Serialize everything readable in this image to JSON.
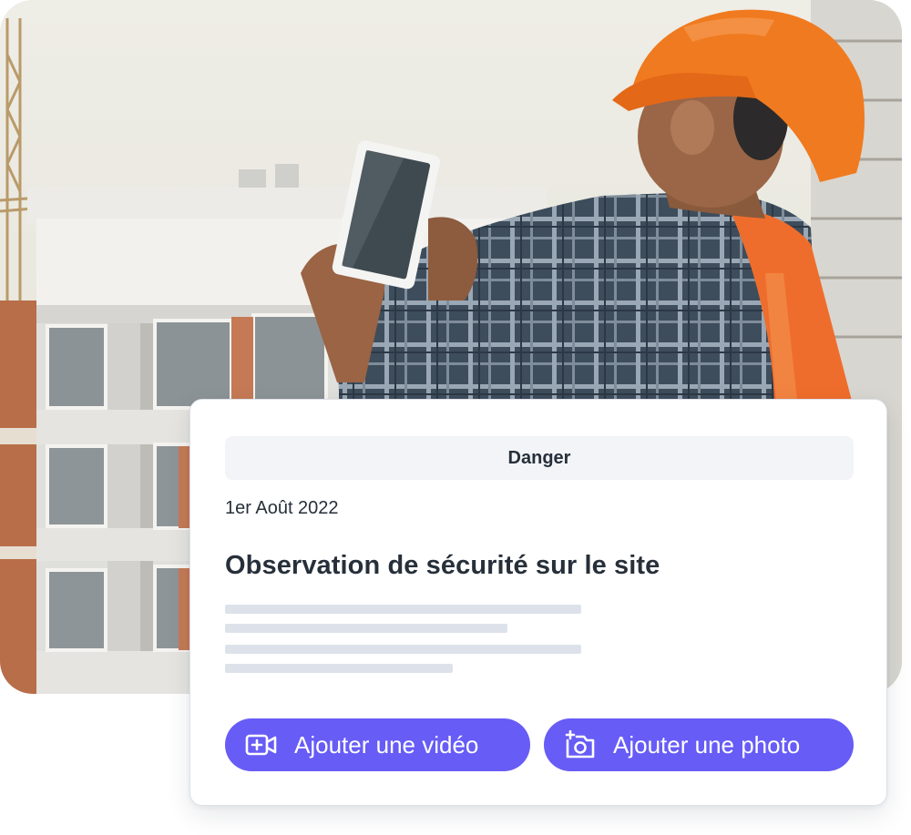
{
  "hero": {
    "image": "construction-worker-tablet-photo"
  },
  "card": {
    "badge": "Danger",
    "date": "1er Août 2022",
    "title": "Observation de sécurité sur le site",
    "buttons": {
      "video": {
        "label": "Ajouter une vidéo",
        "icon": "video-plus-icon"
      },
      "photo": {
        "label": "Ajouter une photo",
        "icon": "camera-plus-icon"
      }
    }
  },
  "colors": {
    "accent": "#675cf6",
    "text": "#27303a",
    "badge_bg": "#f3f4f8",
    "placeholder_line": "#dde2ea"
  }
}
